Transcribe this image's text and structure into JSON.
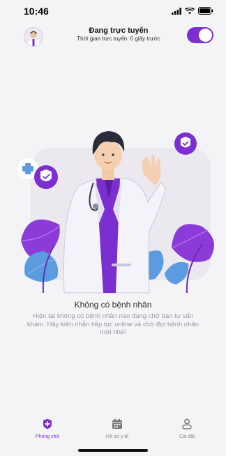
{
  "status_bar": {
    "time": "10:46"
  },
  "header": {
    "title": "Đang trực tuyến",
    "subtitle": "Thời gian trực tuyến: 0 giây trước",
    "online_toggle_on": true
  },
  "empty_state": {
    "title": "Không có bệnh nhân",
    "description": "Hiện tại không có bệnh nhân nào đang chờ bạn tư vấn khám. Hãy kiên nhẫn tiếp tục online và chờ đợi bệnh nhân mới nhé!"
  },
  "tabs": [
    {
      "label": "Phòng chờ",
      "icon": "shield-icon",
      "active": true
    },
    {
      "label": "Hồ sơ y tế",
      "icon": "calendar-icon",
      "active": false
    },
    {
      "label": "Cài đặt",
      "icon": "person-icon",
      "active": false
    }
  ],
  "colors": {
    "accent": "#7b2fd0",
    "leaf_blue": "#5b9be0"
  }
}
